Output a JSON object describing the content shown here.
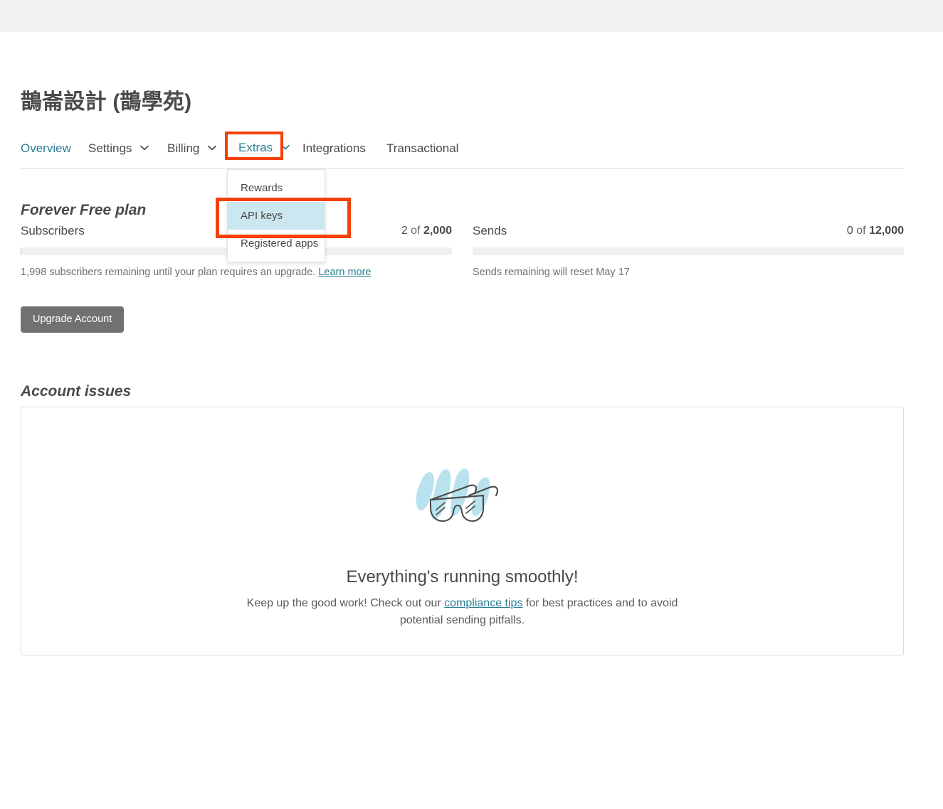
{
  "account": {
    "title": "鵲崙設計 (鵲學苑)"
  },
  "tabs": [
    {
      "id": "overview",
      "label": "Overview",
      "active": true,
      "caret": false
    },
    {
      "id": "settings",
      "label": "Settings",
      "active": false,
      "caret": true
    },
    {
      "id": "billing",
      "label": "Billing",
      "active": false,
      "caret": true
    },
    {
      "id": "extras",
      "label": "Extras",
      "active": false,
      "caret": true,
      "highlighted": true
    },
    {
      "id": "integrations",
      "label": "Integrations",
      "active": false,
      "caret": false
    },
    {
      "id": "transactional",
      "label": "Transactional",
      "active": false,
      "caret": false
    }
  ],
  "dropdown": {
    "open_for": "Extras",
    "items": [
      {
        "label": "Rewards",
        "selected": false
      },
      {
        "label": "API keys",
        "selected": true
      },
      {
        "label": "Registered apps",
        "selected": false
      }
    ]
  },
  "plan": {
    "title": "Forever Free plan",
    "subscribers": {
      "label": "Subscribers",
      "used": "2",
      "of": " of ",
      "limit": "2,000",
      "note_prefix": "1,998 subscribers remaining until your plan requires an upgrade. ",
      "note_link": "Learn more",
      "percent": 0.1
    },
    "sends": {
      "label": "Sends",
      "used": "0",
      "of": " of ",
      "limit": "12,000",
      "note": "Sends remaining will reset May 17",
      "percent": 0
    },
    "upgrade_button": "Upgrade Account"
  },
  "issues": {
    "title": "Account issues",
    "headline": "Everything's running smoothly!",
    "body_prefix": "Keep up the good work! Check out our ",
    "body_link": "compliance tips",
    "body_suffix": " for best practices and to avoid potential sending pitfalls.",
    "illustration": "sunglasses-icon"
  },
  "colors": {
    "highlight_box": "#f5400a",
    "dropdown_selected": "#cbe7ef",
    "link": "#2a7f94",
    "button": "#717171",
    "topbar": "#f1f1f1",
    "illustration_accent": "#b9e2ef",
    "illustration_stroke": "#4a4a4a"
  }
}
